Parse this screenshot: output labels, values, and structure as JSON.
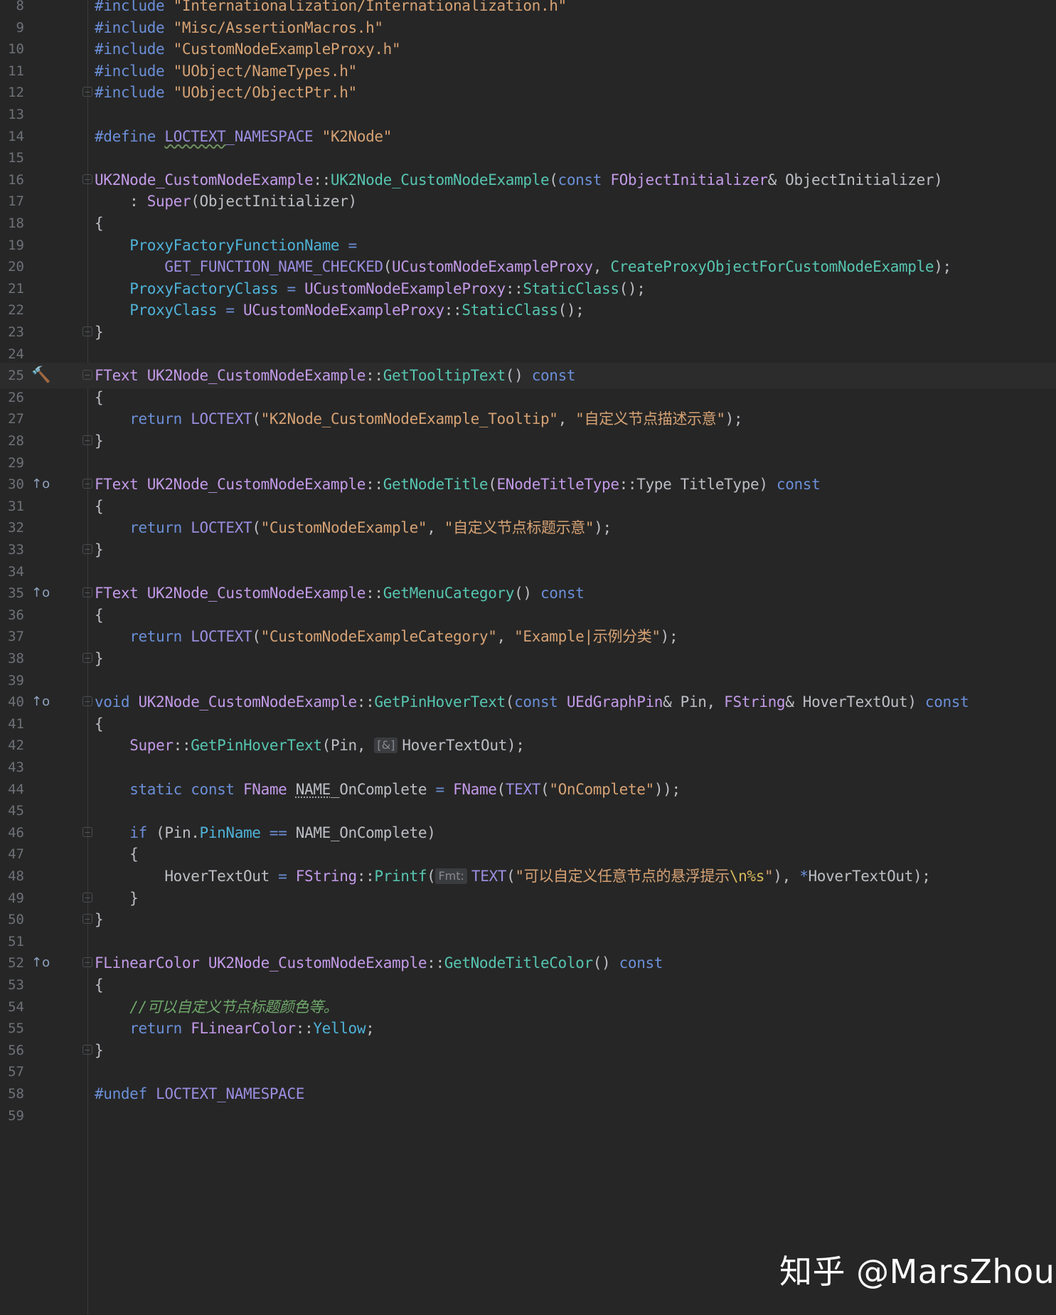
{
  "editor": {
    "current_line": "25",
    "lines": [
      {
        "n": "8",
        "fold": false,
        "tokens": [
          {
            "c": "kw",
            "t": "#include "
          },
          {
            "c": "str",
            "t": "\"Internationalization/Internationalization.h\""
          }
        ]
      },
      {
        "n": "9",
        "fold": false,
        "tokens": [
          {
            "c": "kw",
            "t": "#include "
          },
          {
            "c": "str",
            "t": "\"Misc/AssertionMacros.h\""
          }
        ]
      },
      {
        "n": "10",
        "fold": false,
        "tokens": [
          {
            "c": "kw",
            "t": "#include "
          },
          {
            "c": "str",
            "t": "\"CustomNodeExampleProxy.h\""
          }
        ]
      },
      {
        "n": "11",
        "fold": false,
        "tokens": [
          {
            "c": "kw",
            "t": "#include "
          },
          {
            "c": "str",
            "t": "\"UObject/NameTypes.h\""
          }
        ]
      },
      {
        "n": "12",
        "fold": true,
        "tokens": [
          {
            "c": "kw",
            "t": "#include "
          },
          {
            "c": "str",
            "t": "\"UObject/ObjectPtr.h\""
          }
        ]
      },
      {
        "n": "13",
        "fold": false,
        "tokens": []
      },
      {
        "n": "14",
        "fold": false,
        "tokens": [
          {
            "c": "kw",
            "t": "#define "
          },
          {
            "c": "mac wavy",
            "t": "LOCTEXT"
          },
          {
            "c": "mac",
            "t": "_NAMESPACE "
          },
          {
            "c": "str",
            "t": "\"K2Node\""
          }
        ]
      },
      {
        "n": "15",
        "fold": false,
        "tokens": []
      },
      {
        "n": "16",
        "fold": true,
        "tokens": [
          {
            "c": "typ",
            "t": "UK2Node_CustomNodeExample"
          },
          {
            "c": "txt",
            "t": "::"
          },
          {
            "c": "fn",
            "t": "UK2Node_CustomNodeExample"
          },
          {
            "c": "txt",
            "t": "("
          },
          {
            "c": "kw",
            "t": "const "
          },
          {
            "c": "typ",
            "t": "FObjectInitializer"
          },
          {
            "c": "txt",
            "t": "& ObjectInitializer)"
          }
        ]
      },
      {
        "n": "17",
        "fold": false,
        "tokens": [
          {
            "c": "txt",
            "t": "    : "
          },
          {
            "c": "typ",
            "t": "Super"
          },
          {
            "c": "txt",
            "t": "(ObjectInitializer)"
          }
        ]
      },
      {
        "n": "18",
        "fold": false,
        "tokens": [
          {
            "c": "txt",
            "t": "{"
          }
        ]
      },
      {
        "n": "19",
        "fold": false,
        "tokens": [
          {
            "c": "txt",
            "t": "    "
          },
          {
            "c": "fld",
            "t": "ProxyFactoryFunctionName"
          },
          {
            "c": "txt",
            "t": " "
          },
          {
            "c": "kw",
            "t": "="
          }
        ]
      },
      {
        "n": "20",
        "fold": false,
        "tokens": [
          {
            "c": "txt",
            "t": "        "
          },
          {
            "c": "mac",
            "t": "GET_FUNCTION_NAME_CHECKED"
          },
          {
            "c": "txt",
            "t": "("
          },
          {
            "c": "typ",
            "t": "UCustomNodeExampleProxy"
          },
          {
            "c": "txt",
            "t": ", "
          },
          {
            "c": "fn",
            "t": "CreateProxyObjectForCustomNodeExample"
          },
          {
            "c": "txt",
            "t": ");"
          }
        ]
      },
      {
        "n": "21",
        "fold": false,
        "tokens": [
          {
            "c": "txt",
            "t": "    "
          },
          {
            "c": "fld",
            "t": "ProxyFactoryClass"
          },
          {
            "c": "txt",
            "t": " "
          },
          {
            "c": "kw",
            "t": "="
          },
          {
            "c": "txt",
            "t": " "
          },
          {
            "c": "typ",
            "t": "UCustomNodeExampleProxy"
          },
          {
            "c": "txt",
            "t": "::"
          },
          {
            "c": "fn",
            "t": "StaticClass"
          },
          {
            "c": "txt",
            "t": "();"
          }
        ]
      },
      {
        "n": "22",
        "fold": false,
        "tokens": [
          {
            "c": "txt",
            "t": "    "
          },
          {
            "c": "fld",
            "t": "ProxyClass"
          },
          {
            "c": "txt",
            "t": " "
          },
          {
            "c": "kw",
            "t": "="
          },
          {
            "c": "txt",
            "t": " "
          },
          {
            "c": "typ",
            "t": "UCustomNodeExampleProxy"
          },
          {
            "c": "txt",
            "t": "::"
          },
          {
            "c": "fn",
            "t": "StaticClass"
          },
          {
            "c": "txt",
            "t": "();"
          }
        ]
      },
      {
        "n": "23",
        "fold": true,
        "tokens": [
          {
            "c": "txt",
            "t": "}"
          }
        ]
      },
      {
        "n": "24",
        "fold": false,
        "tokens": []
      },
      {
        "n": "25",
        "fold": true,
        "gutter": "hammer-icon",
        "tokens": [
          {
            "c": "typ",
            "t": "FText"
          },
          {
            "c": "txt",
            "t": " "
          },
          {
            "c": "typ",
            "t": "UK2Node_CustomNodeExample"
          },
          {
            "c": "txt",
            "t": "::"
          },
          {
            "c": "fn",
            "t": "GetTooltipText"
          },
          {
            "c": "txt",
            "t": "() "
          },
          {
            "c": "kw",
            "t": "const"
          }
        ]
      },
      {
        "n": "26",
        "fold": false,
        "tokens": [
          {
            "c": "txt",
            "t": "{"
          }
        ]
      },
      {
        "n": "27",
        "fold": false,
        "tokens": [
          {
            "c": "txt",
            "t": "    "
          },
          {
            "c": "kw",
            "t": "return "
          },
          {
            "c": "mac",
            "t": "LOCTEXT"
          },
          {
            "c": "txt",
            "t": "("
          },
          {
            "c": "str",
            "t": "\"K2Node_CustomNodeExample_Tooltip\""
          },
          {
            "c": "txt",
            "t": ", "
          },
          {
            "c": "str",
            "t": "\"自定义节点描述示意\""
          },
          {
            "c": "txt",
            "t": ");"
          }
        ]
      },
      {
        "n": "28",
        "fold": true,
        "tokens": [
          {
            "c": "txt",
            "t": "}"
          }
        ]
      },
      {
        "n": "29",
        "fold": false,
        "tokens": []
      },
      {
        "n": "30",
        "fold": true,
        "gutter": "override-icon",
        "tokens": [
          {
            "c": "typ",
            "t": "FText"
          },
          {
            "c": "txt",
            "t": " "
          },
          {
            "c": "typ",
            "t": "UK2Node_CustomNodeExample"
          },
          {
            "c": "txt",
            "t": "::"
          },
          {
            "c": "fn",
            "t": "GetNodeTitle"
          },
          {
            "c": "txt",
            "t": "("
          },
          {
            "c": "typ",
            "t": "ENodeTitleType"
          },
          {
            "c": "txt",
            "t": "::Type TitleType) "
          },
          {
            "c": "kw",
            "t": "const"
          }
        ]
      },
      {
        "n": "31",
        "fold": false,
        "tokens": [
          {
            "c": "txt",
            "t": "{"
          }
        ]
      },
      {
        "n": "32",
        "fold": false,
        "tokens": [
          {
            "c": "txt",
            "t": "    "
          },
          {
            "c": "kw",
            "t": "return "
          },
          {
            "c": "mac",
            "t": "LOCTEXT"
          },
          {
            "c": "txt",
            "t": "("
          },
          {
            "c": "str",
            "t": "\"CustomNodeExample\""
          },
          {
            "c": "txt",
            "t": ", "
          },
          {
            "c": "str",
            "t": "\"自定义节点标题示意\""
          },
          {
            "c": "txt",
            "t": ");"
          }
        ]
      },
      {
        "n": "33",
        "fold": true,
        "tokens": [
          {
            "c": "txt",
            "t": "}"
          }
        ]
      },
      {
        "n": "34",
        "fold": false,
        "tokens": []
      },
      {
        "n": "35",
        "fold": true,
        "gutter": "override-icon",
        "tokens": [
          {
            "c": "typ",
            "t": "FText"
          },
          {
            "c": "txt",
            "t": " "
          },
          {
            "c": "typ",
            "t": "UK2Node_CustomNodeExample"
          },
          {
            "c": "txt",
            "t": "::"
          },
          {
            "c": "fn",
            "t": "GetMenuCategory"
          },
          {
            "c": "txt",
            "t": "() "
          },
          {
            "c": "kw",
            "t": "const"
          }
        ]
      },
      {
        "n": "36",
        "fold": false,
        "tokens": [
          {
            "c": "txt",
            "t": "{"
          }
        ]
      },
      {
        "n": "37",
        "fold": false,
        "tokens": [
          {
            "c": "txt",
            "t": "    "
          },
          {
            "c": "kw",
            "t": "return "
          },
          {
            "c": "mac",
            "t": "LOCTEXT"
          },
          {
            "c": "txt",
            "t": "("
          },
          {
            "c": "str",
            "t": "\"CustomNodeExampleCategory\""
          },
          {
            "c": "txt",
            "t": ", "
          },
          {
            "c": "str",
            "t": "\"Example|示例分类\""
          },
          {
            "c": "txt",
            "t": ");"
          }
        ]
      },
      {
        "n": "38",
        "fold": true,
        "tokens": [
          {
            "c": "txt",
            "t": "}"
          }
        ]
      },
      {
        "n": "39",
        "fold": false,
        "tokens": []
      },
      {
        "n": "40",
        "fold": true,
        "gutter": "override-icon",
        "tokens": [
          {
            "c": "kw",
            "t": "void "
          },
          {
            "c": "typ",
            "t": "UK2Node_CustomNodeExample"
          },
          {
            "c": "txt",
            "t": "::"
          },
          {
            "c": "fn",
            "t": "GetPinHoverText"
          },
          {
            "c": "txt",
            "t": "("
          },
          {
            "c": "kw",
            "t": "const "
          },
          {
            "c": "typ",
            "t": "UEdGraphPin"
          },
          {
            "c": "txt",
            "t": "& Pin, "
          },
          {
            "c": "typ",
            "t": "FString"
          },
          {
            "c": "txt",
            "t": "& HoverTextOut) "
          },
          {
            "c": "kw",
            "t": "const"
          }
        ]
      },
      {
        "n": "41",
        "fold": false,
        "tokens": [
          {
            "c": "txt",
            "t": "{"
          }
        ]
      },
      {
        "n": "42",
        "fold": false,
        "tokens": [
          {
            "c": "txt",
            "t": "    "
          },
          {
            "c": "typ",
            "t": "Super"
          },
          {
            "c": "txt",
            "t": "::"
          },
          {
            "c": "fn",
            "t": "GetPinHoverText"
          },
          {
            "c": "txt",
            "t": "(Pin, "
          },
          {
            "c": "hint",
            "t": "[&]"
          },
          {
            "c": "txt",
            "t": "HoverTextOut);"
          }
        ]
      },
      {
        "n": "43",
        "fold": false,
        "tokens": []
      },
      {
        "n": "44",
        "fold": false,
        "tokens": [
          {
            "c": "txt",
            "t": "    "
          },
          {
            "c": "kw",
            "t": "static const "
          },
          {
            "c": "typ",
            "t": "FName"
          },
          {
            "c": "txt",
            "t": " "
          },
          {
            "c": "txt dotted",
            "t": "NAME"
          },
          {
            "c": "txt",
            "t": "_OnComplete "
          },
          {
            "c": "kw",
            "t": "="
          },
          {
            "c": "txt",
            "t": " "
          },
          {
            "c": "typ",
            "t": "FName"
          },
          {
            "c": "txt",
            "t": "("
          },
          {
            "c": "mac",
            "t": "TEXT"
          },
          {
            "c": "txt",
            "t": "("
          },
          {
            "c": "str",
            "t": "\"OnComplete\""
          },
          {
            "c": "txt",
            "t": "));"
          }
        ]
      },
      {
        "n": "45",
        "fold": false,
        "tokens": []
      },
      {
        "n": "46",
        "fold": true,
        "tokens": [
          {
            "c": "txt",
            "t": "    "
          },
          {
            "c": "kw",
            "t": "if"
          },
          {
            "c": "txt",
            "t": " (Pin."
          },
          {
            "c": "fld",
            "t": "PinName"
          },
          {
            "c": "txt",
            "t": " "
          },
          {
            "c": "kw",
            "t": "=="
          },
          {
            "c": "txt",
            "t": " NAME_OnComplete)"
          }
        ]
      },
      {
        "n": "47",
        "fold": false,
        "tokens": [
          {
            "c": "txt",
            "t": "    {"
          }
        ]
      },
      {
        "n": "48",
        "fold": false,
        "tokens": [
          {
            "c": "txt",
            "t": "        HoverTextOut "
          },
          {
            "c": "kw",
            "t": "="
          },
          {
            "c": "txt",
            "t": " "
          },
          {
            "c": "typ",
            "t": "FString"
          },
          {
            "c": "txt",
            "t": "::"
          },
          {
            "c": "fn",
            "t": "Printf"
          },
          {
            "c": "txt",
            "t": "("
          },
          {
            "c": "hint",
            "t": "Fmt:"
          },
          {
            "c": "mac",
            "t": "TEXT"
          },
          {
            "c": "txt",
            "t": "("
          },
          {
            "c": "str",
            "t": "\"可以自定义任意节点的悬浮提示"
          },
          {
            "c": "esc",
            "t": "\\n%s"
          },
          {
            "c": "str",
            "t": "\""
          },
          {
            "c": "txt",
            "t": "), "
          },
          {
            "c": "kw",
            "t": "*"
          },
          {
            "c": "txt",
            "t": "HoverTextOut);"
          }
        ]
      },
      {
        "n": "49",
        "fold": true,
        "tokens": [
          {
            "c": "txt",
            "t": "    }"
          }
        ]
      },
      {
        "n": "50",
        "fold": true,
        "tokens": [
          {
            "c": "txt",
            "t": "}"
          }
        ]
      },
      {
        "n": "51",
        "fold": false,
        "tokens": []
      },
      {
        "n": "52",
        "fold": true,
        "gutter": "override-icon",
        "tokens": [
          {
            "c": "typ",
            "t": "FLinearColor"
          },
          {
            "c": "txt",
            "t": " "
          },
          {
            "c": "typ",
            "t": "UK2Node_CustomNodeExample"
          },
          {
            "c": "txt",
            "t": "::"
          },
          {
            "c": "fn",
            "t": "GetNodeTitleColor"
          },
          {
            "c": "txt",
            "t": "() "
          },
          {
            "c": "kw",
            "t": "const"
          }
        ]
      },
      {
        "n": "53",
        "fold": false,
        "tokens": [
          {
            "c": "txt",
            "t": "{"
          }
        ]
      },
      {
        "n": "54",
        "fold": false,
        "tokens": [
          {
            "c": "txt",
            "t": "    "
          },
          {
            "c": "cmt",
            "t": "//可以自定义节点标题颜色等。"
          }
        ]
      },
      {
        "n": "55",
        "fold": false,
        "tokens": [
          {
            "c": "txt",
            "t": "    "
          },
          {
            "c": "kw",
            "t": "return "
          },
          {
            "c": "typ",
            "t": "FLinearColor"
          },
          {
            "c": "txt",
            "t": "::"
          },
          {
            "c": "fld",
            "t": "Yellow"
          },
          {
            "c": "txt",
            "t": ";"
          }
        ]
      },
      {
        "n": "56",
        "fold": true,
        "tokens": [
          {
            "c": "txt",
            "t": "}"
          }
        ]
      },
      {
        "n": "57",
        "fold": false,
        "tokens": []
      },
      {
        "n": "58",
        "fold": false,
        "tokens": [
          {
            "c": "kw",
            "t": "#undef "
          },
          {
            "c": "mac",
            "t": "LOCTEXT_NAMESPACE"
          }
        ]
      },
      {
        "n": "59",
        "fold": false,
        "tokens": []
      }
    ]
  },
  "icons": {
    "hammer-icon": "🔨",
    "override-icon": "↑o"
  },
  "colors": {
    "background": "#262626",
    "keyword": "#6b8fd8",
    "string": "#d6a274",
    "macro": "#9c8de0",
    "function": "#56c5b0",
    "type": "#c39ae8",
    "field": "#4fb2d8",
    "comment": "#6fa86a"
  },
  "watermark": "知乎 @MarsZhou"
}
